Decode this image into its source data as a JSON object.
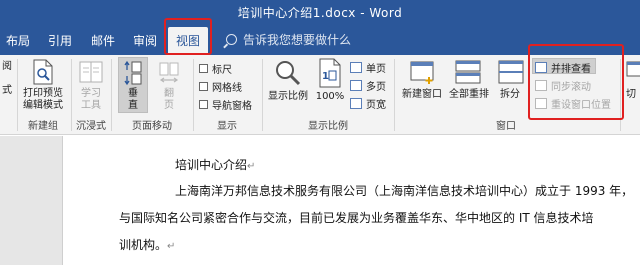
{
  "window": {
    "title": "培训中心介绍1.docx  -  Word"
  },
  "tabs": [
    {
      "label": "布局"
    },
    {
      "label": "引用"
    },
    {
      "label": "邮件"
    },
    {
      "label": "审阅"
    },
    {
      "label": "视图"
    }
  ],
  "tell_me": {
    "placeholder": "告诉我您想要做什么"
  },
  "ribbon": {
    "views": {
      "read_mode_top": "阅",
      "read_mode_bottom": "式"
    },
    "immersive": {
      "print_preview": "打印预览",
      "print_preview2": "编辑模式",
      "learning_tools": "学习",
      "learning_tools2": "工具",
      "group_new": "新建组",
      "group_immersive": "沉浸式"
    },
    "page_move": {
      "vertical": "垂",
      "vertical2": "直",
      "side": "翻",
      "side2": "页",
      "group": "页面移动"
    },
    "show": {
      "ruler": "标尺",
      "gridlines": "网格线",
      "nav_pane": "导航窗格",
      "group": "显示"
    },
    "zoom": {
      "zoom": "显示比例",
      "hundred": "100%",
      "one_page": "单页",
      "multi_page": "多页",
      "page_width": "页宽",
      "group": "显示比例"
    },
    "window": {
      "new_window": "新建窗口",
      "arrange_all": "全部重排",
      "split": "拆分",
      "side_by_side": "并排查看",
      "sync_scroll": "同步滚动",
      "reset_pos": "重设窗口位置",
      "group": "窗口"
    },
    "switch": {
      "label": "切"
    }
  },
  "document": {
    "heading": "培训中心介绍",
    "line1": "上海南洋万邦信息技术服务有限公司（上海南洋信息技术培训中心）成立于 1993 年，",
    "line2": "与国际知名公司紧密合作与交流，目前已发展为业务覆盖华东、华中地区的 IT 信息技术培",
    "line3": "训机构。",
    "para_mark": "↵"
  }
}
